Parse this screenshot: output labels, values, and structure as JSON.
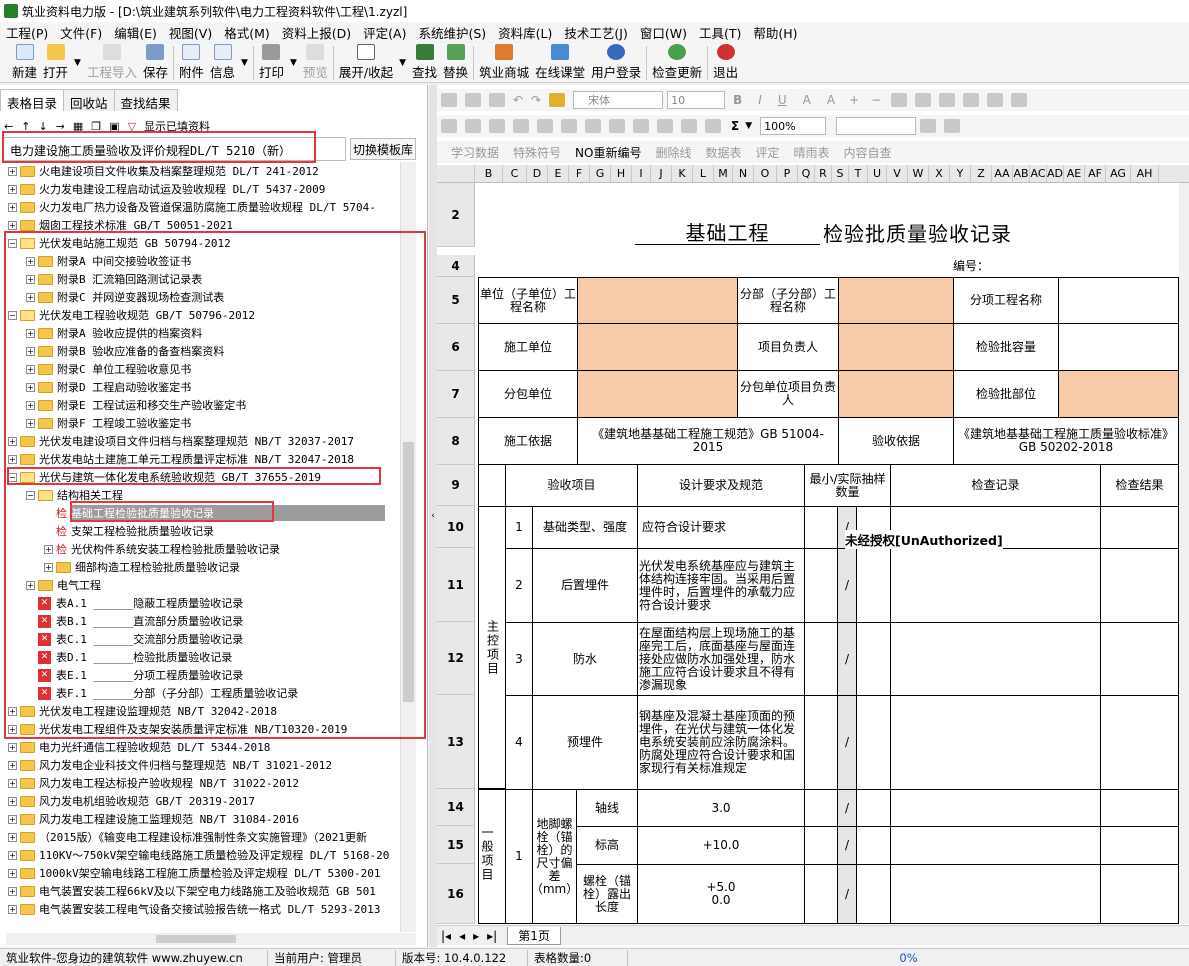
{
  "window": {
    "title": "筑业资料电力版 - [D:\\筑业建筑系列软件\\电力工程资料软件\\工程\\1.zyzl]"
  },
  "menu": [
    "工程(P)",
    "文件(F)",
    "编辑(E)",
    "视图(V)",
    "格式(M)",
    "资料上报(D)",
    "评定(A)",
    "系统维护(S)",
    "资料库(L)",
    "技术工艺(J)",
    "窗口(W)",
    "工具(T)",
    "帮助(H)"
  ],
  "toolbar": {
    "new": "新建",
    "open": "打开",
    "import": "工程导入",
    "save": "保存",
    "attach": "附件",
    "info": "信息",
    "print": "打印",
    "preview": "预览",
    "expand": "展开/收起",
    "find": "查找",
    "replace": "替换",
    "mall": "筑业商城",
    "classroom": "在线课堂",
    "login": "用户登录",
    "update": "检查更新",
    "exit": "退出"
  },
  "left": {
    "tabs": [
      "表格目录",
      "回收站",
      "查找结果"
    ],
    "show_filled": "显示已填资料",
    "combo_value": "电力建设施工质量验收及评价规程DL/T 5210（新）",
    "switch_button": "切换模板库",
    "tree": [
      {
        "level": 0,
        "type": "folder",
        "exp": "+",
        "label": "火电建设项目文件收集及档案整理规范 DL/T 241-2012"
      },
      {
        "level": 0,
        "type": "folder",
        "exp": "+",
        "label": "火力发电建设工程启动试运及验收规程 DL/T 5437-2009"
      },
      {
        "level": 0,
        "type": "folder",
        "exp": "+",
        "label": "火力发电厂热力设备及管道保温防腐施工质量验收规程 DL/T 5704-"
      },
      {
        "level": 0,
        "type": "folder",
        "exp": "+",
        "label": "烟囱工程技术标准 GB/T 50051-2021"
      },
      {
        "level": 0,
        "type": "open",
        "exp": "-",
        "label": "光伏发电站施工规范 GB 50794-2012"
      },
      {
        "level": 1,
        "type": "folder",
        "exp": "+",
        "label": "附录A 中间交接验收签证书"
      },
      {
        "level": 1,
        "type": "folder",
        "exp": "+",
        "label": "附录B 汇流箱回路测试记录表"
      },
      {
        "level": 1,
        "type": "folder",
        "exp": "+",
        "label": "附录C 并网逆变器现场检查测试表"
      },
      {
        "level": 0,
        "type": "open",
        "exp": "-",
        "label": "光伏发电工程验收规范 GB/T 50796-2012"
      },
      {
        "level": 1,
        "type": "folder",
        "exp": "+",
        "label": "附录A 验收应提供的档案资料"
      },
      {
        "level": 1,
        "type": "folder",
        "exp": "+",
        "label": "附录B 验收应准备的备查档案资料"
      },
      {
        "level": 1,
        "type": "folder",
        "exp": "+",
        "label": "附录C 单位工程验收意见书"
      },
      {
        "level": 1,
        "type": "folder",
        "exp": "+",
        "label": "附录D 工程启动验收鉴定书"
      },
      {
        "level": 1,
        "type": "folder",
        "exp": "+",
        "label": "附录E 工程试运和移交生产验收鉴定书"
      },
      {
        "level": 1,
        "type": "folder",
        "exp": "+",
        "label": "附录F 工程竣工验收鉴定书"
      },
      {
        "level": 0,
        "type": "folder",
        "exp": "+",
        "label": "光伏发电建设项目文件归档与档案整理规范 NB/T 32037-2017"
      },
      {
        "level": 0,
        "type": "folder",
        "exp": "+",
        "label": "光伏发电站土建施工单元工程质量评定标准 NB/T 32047-2018"
      },
      {
        "level": 0,
        "type": "open",
        "exp": "-",
        "label": "光伏与建筑一体化发电系统验收规范 GB/T 37655-2019"
      },
      {
        "level": 1,
        "type": "open",
        "exp": "-",
        "label": "结构相关工程"
      },
      {
        "level": 2,
        "type": "doc",
        "exp": "",
        "label": "基础工程检验批质量验收记录",
        "selected": true
      },
      {
        "level": 2,
        "type": "doc",
        "exp": "",
        "label": "支架工程检验批质量验收记录"
      },
      {
        "level": 2,
        "type": "doc",
        "exp": "+",
        "label": "光伏构件系统安装工程检验批质量验收记录"
      },
      {
        "level": 2,
        "type": "folder",
        "exp": "+",
        "label": "细部构造工程检验批质量验收记录"
      },
      {
        "level": 1,
        "type": "folder",
        "exp": "+",
        "label": "电气工程"
      },
      {
        "level": 1,
        "type": "x",
        "exp": "",
        "label": "表A.1 ______隐蔽工程质量验收记录"
      },
      {
        "level": 1,
        "type": "x",
        "exp": "",
        "label": "表B.1 ______直流部分质量验收记录"
      },
      {
        "level": 1,
        "type": "x",
        "exp": "",
        "label": "表C.1 ______交流部分质量验收记录"
      },
      {
        "level": 1,
        "type": "x",
        "exp": "",
        "label": "表D.1 ______检验批质量验收记录"
      },
      {
        "level": 1,
        "type": "x",
        "exp": "",
        "label": "表E.1 ______分项工程质量验收记录"
      },
      {
        "level": 1,
        "type": "x",
        "exp": "",
        "label": "表F.1 ______分部（子分部）工程质量验收记录"
      },
      {
        "level": 0,
        "type": "folder",
        "exp": "+",
        "label": "光伏发电工程建设监理规范 NB/T 32042-2018"
      },
      {
        "level": 0,
        "type": "folder",
        "exp": "+",
        "label": "光伏发电工程组件及支架安装质量评定标准 NB/T10320-2019"
      },
      {
        "level": 0,
        "type": "folder",
        "exp": "+",
        "label": "电力光纤通信工程验收规范 DL/T 5344-2018"
      },
      {
        "level": 0,
        "type": "folder",
        "exp": "+",
        "label": "风力发电企业科技文件归档与整理规范 NB/T 31021-2012"
      },
      {
        "level": 0,
        "type": "folder",
        "exp": "+",
        "label": "风力发电工程达标投产验收规程 NB/T 31022-2012"
      },
      {
        "level": 0,
        "type": "folder",
        "exp": "+",
        "label": "风力发电机组验收规范 GB/T 20319-2017"
      },
      {
        "level": 0,
        "type": "folder",
        "exp": "+",
        "label": "风力发电工程建设施工监理规范 NB/T 31084-2016"
      },
      {
        "level": 0,
        "type": "folder",
        "exp": "+",
        "label": "（2015版）《输变电工程建设标准强制性条文实施管理》（2021更新"
      },
      {
        "level": 0,
        "type": "folder",
        "exp": "+",
        "label": "110KV～750kV架空输电线路施工质量检验及评定规程 DL/T 5168-20"
      },
      {
        "level": 0,
        "type": "folder",
        "exp": "+",
        "label": "1000kV架空输电线路工程施工质量检验及评定规程 DL/T 5300-201"
      },
      {
        "level": 0,
        "type": "folder",
        "exp": "+",
        "label": "电气装置安装工程66kV及以下架空电力线路施工及验收规范 GB 501"
      },
      {
        "level": 0,
        "type": "folder",
        "exp": "+",
        "label": "电气装置安装工程电气设备交接试验报告统一格式 DL/T 5293-2013"
      }
    ]
  },
  "right": {
    "toolbar1": {
      "font": "宋体",
      "size": "10"
    },
    "toolbar2": {
      "zoom": "100%"
    },
    "toolbar3": [
      "学习数据",
      "特殊符号",
      "NO重新编号",
      "删除线",
      "数据表",
      "评定",
      "晴雨表",
      "内容自查"
    ],
    "columns": [
      "B",
      "C",
      "D",
      "E",
      "F",
      "G",
      "H",
      "I",
      "J",
      "K",
      "L",
      "M",
      "N",
      "O",
      "P",
      "Q",
      "R",
      "S",
      "T",
      "U",
      "V",
      "W",
      "X",
      "Y",
      "Z",
      "AA",
      "AB",
      "AC",
      "AD",
      "AE",
      "AF",
      "AG",
      "AH"
    ],
    "rows": [
      "2",
      "4",
      "5",
      "6",
      "7",
      "8",
      "9",
      "10",
      "11",
      "12",
      "13",
      "14",
      "15",
      "16"
    ],
    "form": {
      "title_part1": "基础工程",
      "title_part2": "检验批质量验收记录",
      "number_label": "编号：",
      "unit_name": "单位（子单位）工程名称",
      "division_name": "分部（子分部）工程名称",
      "item_name": "分项工程名称",
      "contractor": "施工单位",
      "project_leader": "项目负责人",
      "batch_capacity": "检验批容量",
      "subcontractor": "分包单位",
      "sub_leader": "分包单位项目负责人",
      "batch_location": "检验批部位",
      "basis_label": "施工依据",
      "basis_value": "《建筑地基基础工程施工规范》GB 51004-2015",
      "accept_basis_label": "验收依据",
      "accept_basis_value": "《建筑地基基础工程施工质量验收标准》GB 50202-2018",
      "h_items": "验收项目",
      "h_design": "设计要求及规范",
      "h_sample": "最小/实际抽样数量",
      "h_record": "检查记录",
      "h_result": "检查结果",
      "main_control": "主控项目",
      "general": "一般项目",
      "unauthorized": "未经授权[UnAuthorized]",
      "items": [
        {
          "no": "1",
          "name": "基础类型、强度",
          "req": "应符合设计要求",
          "slash": "/"
        },
        {
          "no": "2",
          "name": "后置埋件",
          "req": "光伏发电系统基座应与建筑主体结构连接牢固。当采用后置埋件时，后置埋件的承载力应符合设计要求",
          "slash": "/"
        },
        {
          "no": "3",
          "name": "防水",
          "req": "在屋面结构层上现场施工的基座完工后，底面基座与屋面连接处应做防水加强处理，防水施工应符合设计要求且不得有渗漏现象",
          "slash": "/"
        },
        {
          "no": "4",
          "name": "预埋件",
          "req": "钢基座及混凝土基座顶面的预埋件，在光伏与建筑一体化发电系统安装前应涂防腐涂料。防腐处理应符合设计要求和国家现行有关标准规定",
          "slash": "/"
        }
      ],
      "general_items": {
        "no": "1",
        "name": "地脚螺栓（锚栓）的尺寸偏差（mm）",
        "sub": [
          {
            "name": "轴线",
            "val": "3.0",
            "slash": "/"
          },
          {
            "name": "标高",
            "val": "+10.0",
            "slash": "/"
          },
          {
            "name": "螺栓（锚栓）露出长度",
            "val": "+5.0\n0.0",
            "slash": "/"
          }
        ]
      }
    },
    "sheet_tab": "第1页"
  },
  "status": {
    "company": "筑业软件-您身边的建筑软件 www.zhuyew.cn",
    "user": "当前用户: 管理员",
    "version": "版本号: 10.4.0.122",
    "count": "表格数量:0",
    "progress": "0%"
  }
}
